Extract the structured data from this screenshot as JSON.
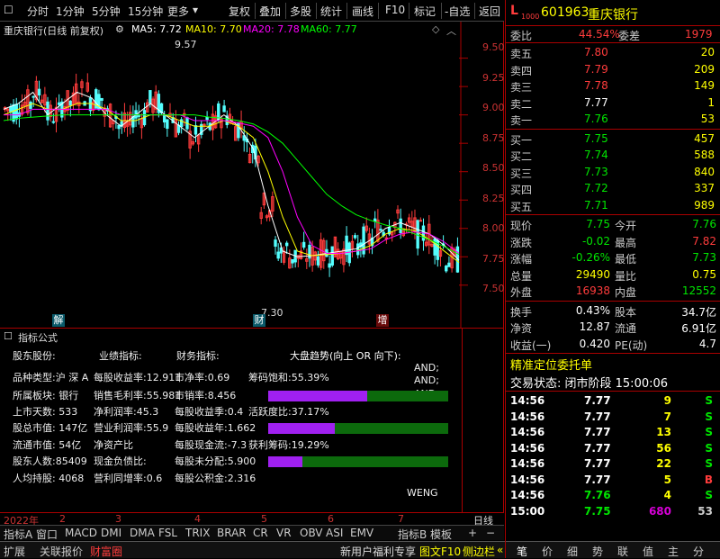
{
  "toolbar": {
    "left_items": [
      "分时",
      "1分钟",
      "5分钟",
      "15分钟",
      "更多"
    ],
    "right_items": [
      "复权",
      "叠加",
      "多股",
      "统计",
      "画线",
      "F10",
      "标记",
      "-自选",
      "返回"
    ]
  },
  "chart": {
    "title": "重庆银行(日线 前复权)",
    "ma": [
      {
        "label": "MA5: 7.72",
        "color": "#ffffff"
      },
      {
        "label": "MA10: 7.70",
        "color": "#ffff00"
      },
      {
        "label": "MA20: 7.78",
        "color": "#ff00ff"
      },
      {
        "label": "MA60: 7.77",
        "color": "#00ff00"
      }
    ],
    "y_ticks": [
      "9.50",
      "9.25",
      "9.00",
      "8.75",
      "8.50",
      "8.25",
      "8.00",
      "7.75",
      "7.50"
    ],
    "high_label": "9.57",
    "low_label": "7.30",
    "markers": [
      "解",
      "财",
      "增"
    ]
  },
  "chart_data": {
    "type": "line",
    "title": "重庆银行(日线 前复权)",
    "ylim": [
      7.3,
      9.6
    ],
    "series": [
      {
        "name": "MA5",
        "values": [
          9.05,
          9.1,
          9.2,
          9.0,
          9.1,
          9.2,
          9.15,
          9.0,
          8.9,
          9.0,
          9.1,
          9.0,
          8.9,
          8.8,
          8.9,
          9.0,
          8.9,
          8.7,
          8.2,
          7.8,
          7.75,
          7.76,
          7.78,
          7.8,
          7.82,
          7.9,
          8.0,
          8.05,
          8.0,
          7.95,
          7.85,
          7.72
        ]
      },
      {
        "name": "MA10",
        "values": [
          9.0,
          9.05,
          9.1,
          9.05,
          9.05,
          9.1,
          9.1,
          9.05,
          8.95,
          8.95,
          9.0,
          9.0,
          8.95,
          8.9,
          8.9,
          8.95,
          8.9,
          8.8,
          8.5,
          8.1,
          7.8,
          7.76,
          7.77,
          7.78,
          7.8,
          7.85,
          7.95,
          8.0,
          7.98,
          7.9,
          7.8,
          7.7
        ]
      },
      {
        "name": "MA20",
        "values": [
          9.0,
          9.0,
          9.05,
          9.05,
          9.05,
          9.05,
          9.05,
          9.05,
          9.0,
          9.0,
          9.0,
          9.0,
          9.0,
          8.95,
          8.95,
          8.95,
          8.93,
          8.9,
          8.8,
          8.5,
          8.1,
          7.85,
          7.78,
          7.78,
          7.8,
          7.82,
          7.9,
          7.95,
          7.97,
          7.95,
          7.88,
          7.78
        ]
      },
      {
        "name": "MA60",
        "values": [
          8.95,
          8.97,
          8.98,
          8.99,
          9.0,
          9.0,
          9.0,
          9.0,
          9.0,
          9.0,
          9.0,
          9.0,
          9.0,
          9.0,
          8.98,
          8.97,
          8.95,
          8.92,
          8.85,
          8.75,
          8.6,
          8.45,
          8.3,
          8.2,
          8.12,
          8.07,
          8.03,
          8.0,
          7.95,
          7.9,
          7.84,
          7.77
        ]
      }
    ]
  },
  "ind": {
    "title": "指标公式",
    "tabs": [
      "股东股份:",
      "业绩指标:",
      "财务指标:",
      "大盘趋势(向上 OR 向下):"
    ],
    "col1": [
      "品种类型:沪 深 A",
      "所属板块:    银行",
      "上市天数:    533",
      "股总市值:    147亿",
      "流通市值:    54亿",
      "股东人数:85409",
      "人均持股:  4068"
    ],
    "col2": [
      "每股收益率:12.911",
      "销售毛利率:55.981",
      "净利润率:45.3",
      "营业利润率:55.9",
      "净资产比",
      "现金负债比:",
      "营利同增率:0.6"
    ],
    "col3": [
      "市净率:0.69",
      "市销率:8.456",
      "每股收益季:0.4",
      "每股收益年:1.662",
      "每股现金流:-7.3",
      "每股未分配:5.900",
      "每股公积金:2.316"
    ],
    "col4": [
      "筹码饱和:55.39%",
      "",
      "活跃度比:37.17%",
      "",
      "获利筹码:19.29%",
      ""
    ],
    "and_labels": [
      "AND;",
      "AND;",
      "AND;"
    ],
    "weng": "WENG",
    "bars": [
      0.55,
      0.37,
      0.19
    ]
  },
  "xaxis": {
    "labels": [
      "2022年",
      "2",
      "3",
      "4",
      "5",
      "6",
      "7"
    ],
    "right_label": "日线"
  },
  "indtabs": [
    "指标A",
    "窗口",
    "MACD",
    "DMI",
    "DMA",
    "FSL",
    "TRIX",
    "BRAR",
    "CR",
    "VR",
    "OBV",
    "ASI",
    "EMV",
    "指标B",
    "模板",
    "+",
    "−"
  ],
  "bottom": {
    "left": [
      "扩展",
      "关联报价",
      "财富圈"
    ],
    "right": [
      "新用户福利专享",
      "图文F10",
      "侧边栏"
    ],
    "icons": [
      "笔",
      "价",
      "细",
      "势",
      "联",
      "值",
      "主",
      "分"
    ]
  },
  "quote": {
    "code": "601963",
    "name": "重庆银行",
    "weibi_label": "委比",
    "weibi": "44.54%",
    "weicha_label": "委差",
    "weicha": "1979",
    "sell": [
      {
        "l": "卖五",
        "p": "7.80",
        "v": "20"
      },
      {
        "l": "卖四",
        "p": "7.79",
        "v": "209"
      },
      {
        "l": "卖三",
        "p": "7.78",
        "v": "149"
      },
      {
        "l": "卖二",
        "p": "7.77",
        "v": "1"
      },
      {
        "l": "卖一",
        "p": "7.76",
        "v": "53"
      }
    ],
    "buy": [
      {
        "l": "买一",
        "p": "7.75",
        "v": "457"
      },
      {
        "l": "买二",
        "p": "7.74",
        "v": "588"
      },
      {
        "l": "买三",
        "p": "7.73",
        "v": "840"
      },
      {
        "l": "买四",
        "p": "7.72",
        "v": "337"
      },
      {
        "l": "买五",
        "p": "7.71",
        "v": "989"
      }
    ],
    "stats": [
      {
        "l1": "现价",
        "v1": "7.75",
        "c1": "grn",
        "l2": "今开",
        "v2": "7.76",
        "c2": "grn"
      },
      {
        "l1": "涨跌",
        "v1": "-0.02",
        "c1": "grn",
        "l2": "最高",
        "v2": "7.82",
        "c2": "red"
      },
      {
        "l1": "涨幅",
        "v1": "-0.26%",
        "c1": "grn",
        "l2": "最低",
        "v2": "7.73",
        "c2": "grn"
      },
      {
        "l1": "总量",
        "v1": "29490",
        "c1": "yel",
        "l2": "量比",
        "v2": "0.75",
        "c2": "yel"
      },
      {
        "l1": "外盘",
        "v1": "16938",
        "c1": "red",
        "l2": "内盘",
        "v2": "12552",
        "c2": "grn"
      }
    ],
    "stats2": [
      {
        "l1": "换手",
        "v1": "0.43%",
        "l2": "股本",
        "v2": "34.7亿"
      },
      {
        "l1": "净资",
        "v1": "12.87",
        "l2": "流通",
        "v2": "6.91亿"
      },
      {
        "l1": "收益(一)",
        "v1": "0.420",
        "l2": "PE(动)",
        "v2": "4.7"
      }
    ],
    "jz": "精准定位委托单",
    "status": "交易状态: 闭市阶段 15:00:06",
    "ticks": [
      {
        "t": "14:56",
        "p": "7.77",
        "v": "9",
        "s": "S",
        "pc": "wht",
        "vc": "yel",
        "sc": "grn"
      },
      {
        "t": "14:56",
        "p": "7.77",
        "v": "7",
        "s": "S",
        "pc": "wht",
        "vc": "yel",
        "sc": "grn"
      },
      {
        "t": "14:56",
        "p": "7.77",
        "v": "13",
        "s": "S",
        "pc": "wht",
        "vc": "yel",
        "sc": "grn"
      },
      {
        "t": "14:56",
        "p": "7.77",
        "v": "56",
        "s": "S",
        "pc": "wht",
        "vc": "yel",
        "sc": "grn"
      },
      {
        "t": "14:56",
        "p": "7.77",
        "v": "22",
        "s": "S",
        "pc": "wht",
        "vc": "yel",
        "sc": "grn"
      },
      {
        "t": "14:56",
        "p": "7.77",
        "v": "5",
        "s": "B",
        "pc": "wht",
        "vc": "yel",
        "sc": "red"
      },
      {
        "t": "14:56",
        "p": "7.76",
        "v": "4",
        "s": "S",
        "pc": "grn",
        "vc": "yel",
        "sc": "grn"
      },
      {
        "t": "15:00",
        "p": "7.75",
        "v": "680",
        "s": "53",
        "pc": "grn",
        "vc": "mag",
        "sc": "gry"
      }
    ]
  }
}
